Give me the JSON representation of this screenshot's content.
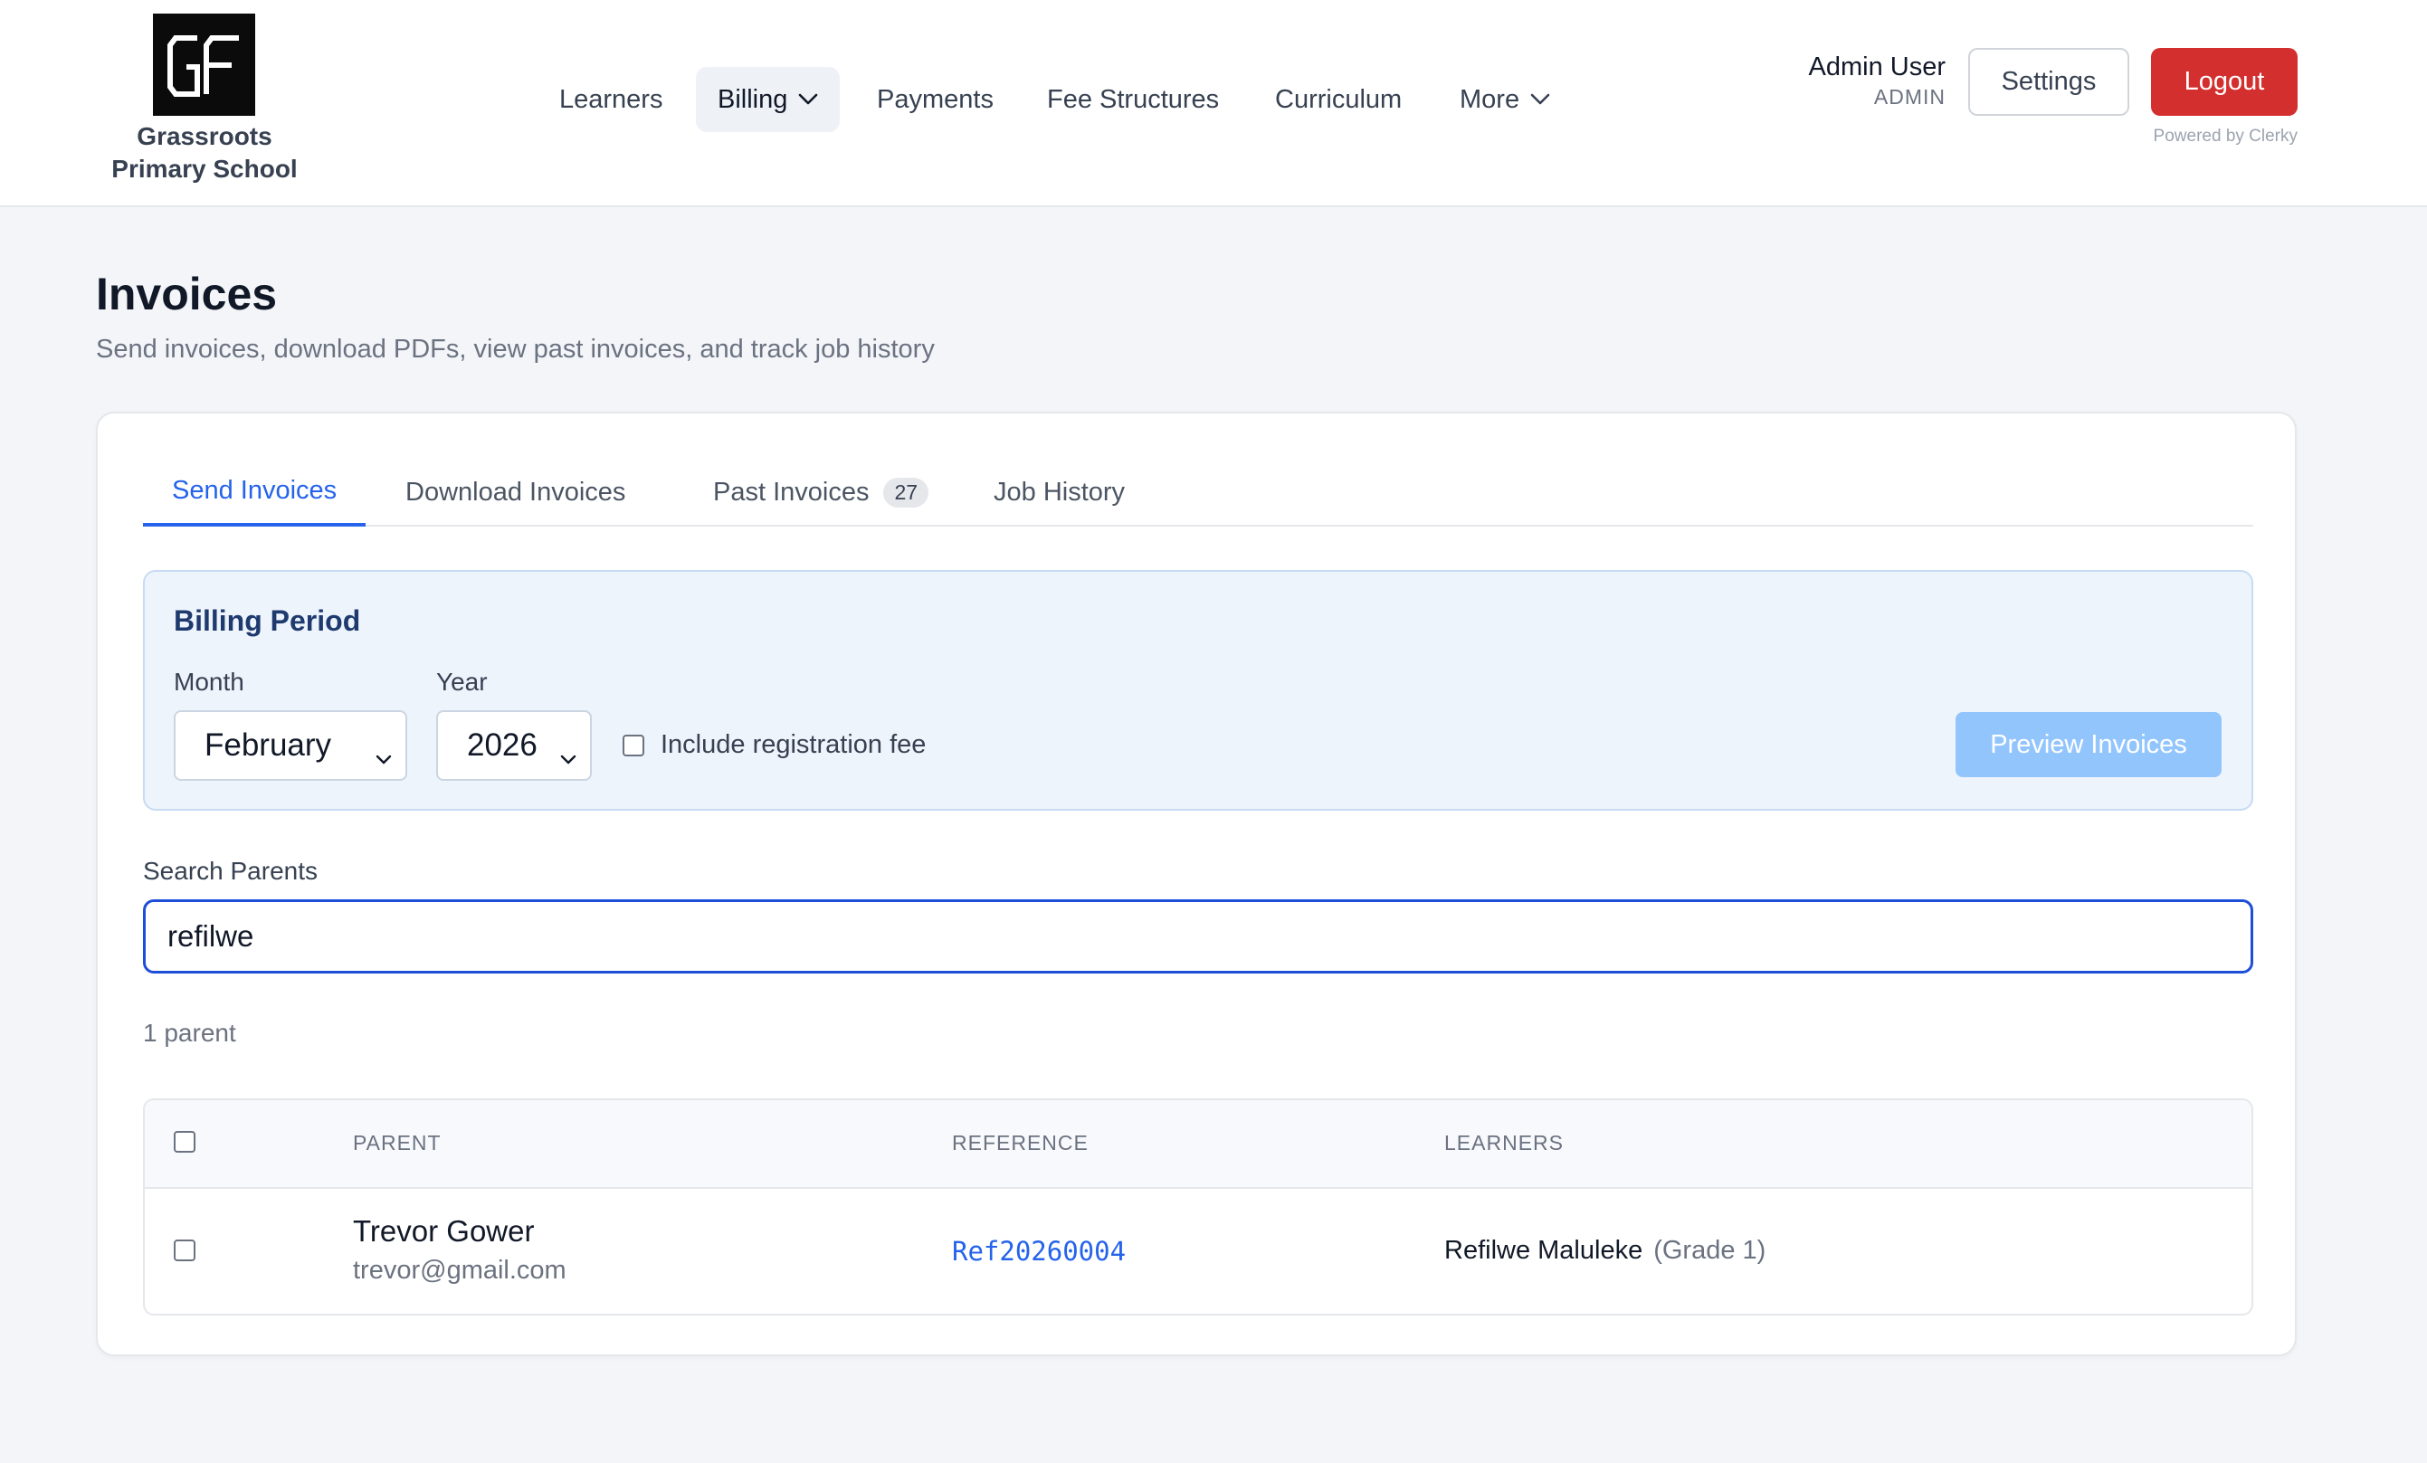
{
  "header": {
    "logo_text": "GF",
    "school_name_line1": "Grassroots",
    "school_name_line2": "Primary School",
    "nav": [
      {
        "label": "Learners",
        "icon": null
      },
      {
        "label": "Billing",
        "icon": "chevron-down-icon",
        "active": true
      },
      {
        "label": "Payments",
        "icon": null
      },
      {
        "label": "Fee Structures",
        "icon": null
      },
      {
        "label": "Curriculum",
        "icon": null
      },
      {
        "label": "More",
        "icon": "chevron-down-icon"
      }
    ],
    "user_name": "Admin User",
    "user_role": "ADMIN",
    "settings_label": "Settings",
    "logout_label": "Logout",
    "powered_by": "Powered by Clerky"
  },
  "page": {
    "title": "Invoices",
    "subtitle": "Send invoices, download PDFs, view past invoices, and track job history"
  },
  "tabs": [
    {
      "label": "Send Invoices",
      "active": true
    },
    {
      "label": "Download Invoices"
    },
    {
      "label": "Past Invoices",
      "badge": "27"
    },
    {
      "label": "Job History"
    }
  ],
  "billing": {
    "title": "Billing Period",
    "month_label": "Month",
    "month_value": "February",
    "year_label": "Year",
    "year_value": "2026",
    "include_reg_fee_label": "Include registration fee",
    "include_reg_fee_checked": false,
    "preview_button": "Preview Invoices"
  },
  "search": {
    "label": "Search Parents",
    "value": "refilwe"
  },
  "results": {
    "count_text": "1 parent",
    "columns": [
      "PARENT",
      "REFERENCE",
      "LEARNERS"
    ],
    "rows": [
      {
        "parent_name": "Trevor Gower",
        "parent_email": "trevor@gmail.com",
        "reference": "Ref20260004",
        "learner_name": "Refilwe Maluleke",
        "learner_grade": "(Grade 1)"
      }
    ]
  },
  "colors": {
    "accent": "#2563eb",
    "logout": "#d32f2f",
    "preview_disabled": "#93c5fd",
    "billing_panel_bg": "#eef4fc"
  }
}
